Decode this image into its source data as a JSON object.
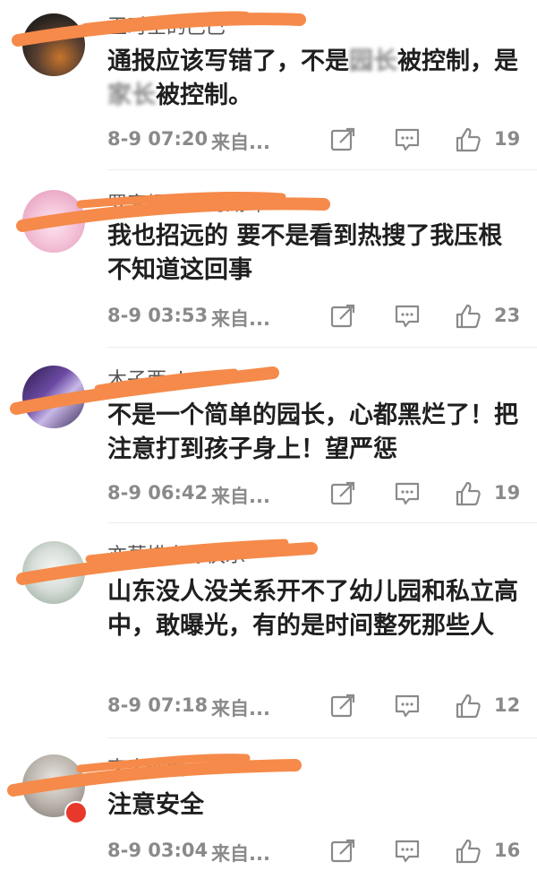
{
  "comments": [
    {
      "username": "王时空的巴巴",
      "text_pre": "通报应该写错了，不是",
      "text_blur1": "园长",
      "text_mid": "被控制，是",
      "text_blur2": "家长",
      "text_post": "被控制。",
      "time": "8-9 07:20",
      "source": "来自...",
      "likes": "19"
    },
    {
      "username": "罗家坝七彩的湖畔",
      "text": "我也招远的 要不是看到热搜了我压根不知道这回事",
      "time": "8-9 03:53",
      "source": "来自...",
      "likes": "23"
    },
    {
      "username": "木子西yle",
      "text": "不是一个简单的园长，心都黑烂了！把注意打到孩子身上！望严惩",
      "time": "8-9 06:42",
      "source": "来自...",
      "likes": "19"
    },
    {
      "username": "亦莫惜自缘快乐",
      "text": "山东没人没关系开不了幼儿园和私立高中，敢曝光，有的是时间整死那些人",
      "time": "8-9 07:18",
      "source": "来自...",
      "likes": "12"
    },
    {
      "username": "李大仙鹏",
      "text": "注意安全",
      "time": "8-9 03:04",
      "source": "来自...",
      "likes": "16"
    }
  ],
  "colors": {
    "redaction": "#f58a4a",
    "meta": "#8a8a8a",
    "badge": "#e8382b"
  },
  "icons": [
    "share-icon",
    "comment-icon",
    "like-icon"
  ]
}
